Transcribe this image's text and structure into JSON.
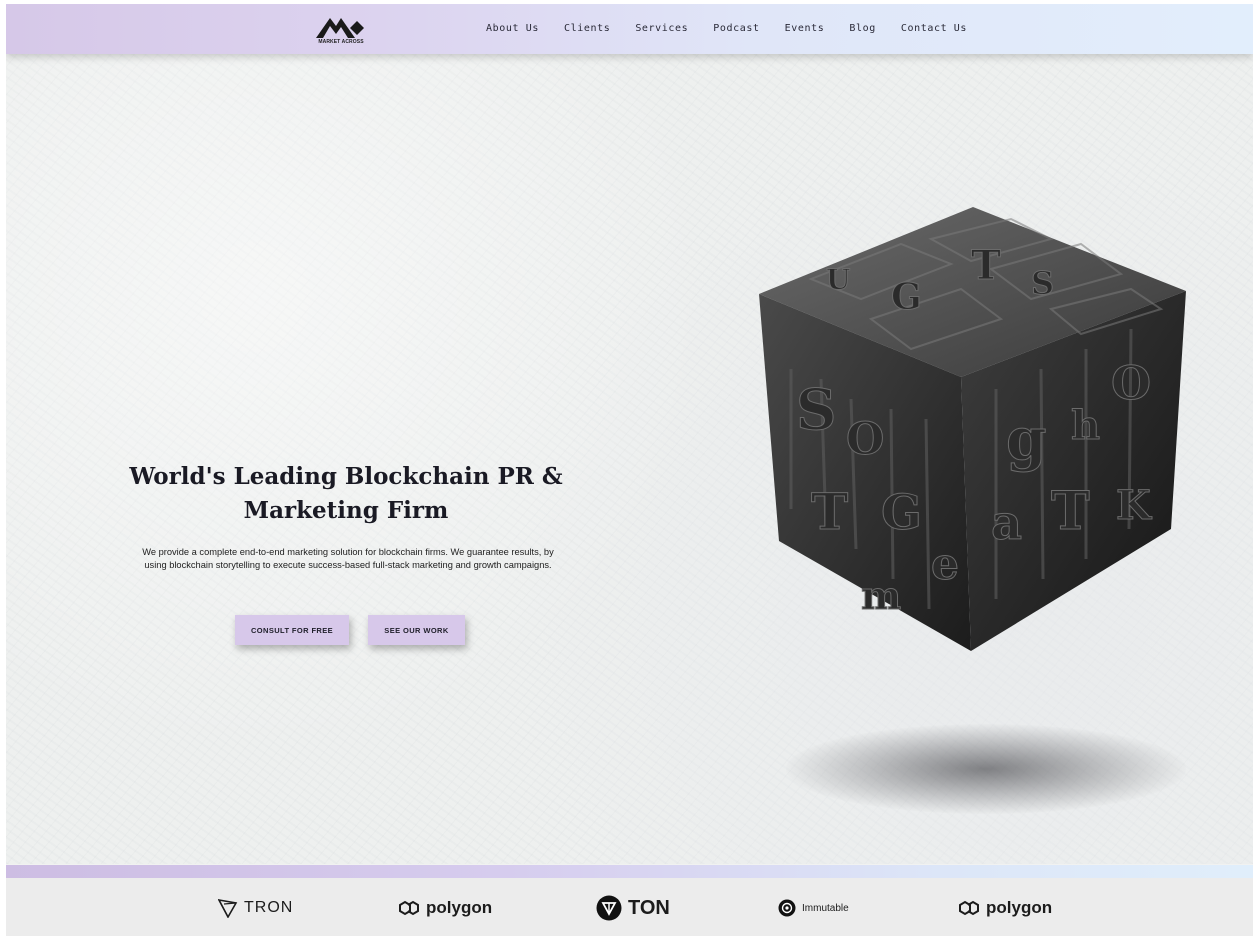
{
  "brand": {
    "logo_text": "MARKET ACROSS"
  },
  "nav": {
    "items": [
      {
        "label": "About Us"
      },
      {
        "label": "Clients"
      },
      {
        "label": "Services"
      },
      {
        "label": "Podcast"
      },
      {
        "label": "Events"
      },
      {
        "label": "Blog"
      },
      {
        "label": "Contact Us"
      }
    ]
  },
  "hero": {
    "title": "World's Leading Blockchain PR & Marketing Firm",
    "description": "We provide a complete end-to-end marketing solution for blockchain firms. We guarantee results, by using blockchain storytelling to execute success-based full-stack marketing and growth campaigns.",
    "cta_primary": "CONSULT FOR FREE",
    "cta_secondary": "SEE OUR WORK"
  },
  "partners": [
    {
      "name": "TRON",
      "icon": "tron-icon"
    },
    {
      "name": "polygon",
      "icon": "polygon-icon"
    },
    {
      "name": "TON",
      "icon": "ton-icon"
    },
    {
      "name": "Immutable",
      "icon": "immutable-icon"
    },
    {
      "name": "polygon",
      "icon": "polygon-icon"
    }
  ],
  "colors": {
    "accent": "#d7c8ea",
    "nav_gradient_start": "#d6c8e8",
    "nav_gradient_end": "#e2eefc",
    "text_dark": "#1a1a24"
  }
}
